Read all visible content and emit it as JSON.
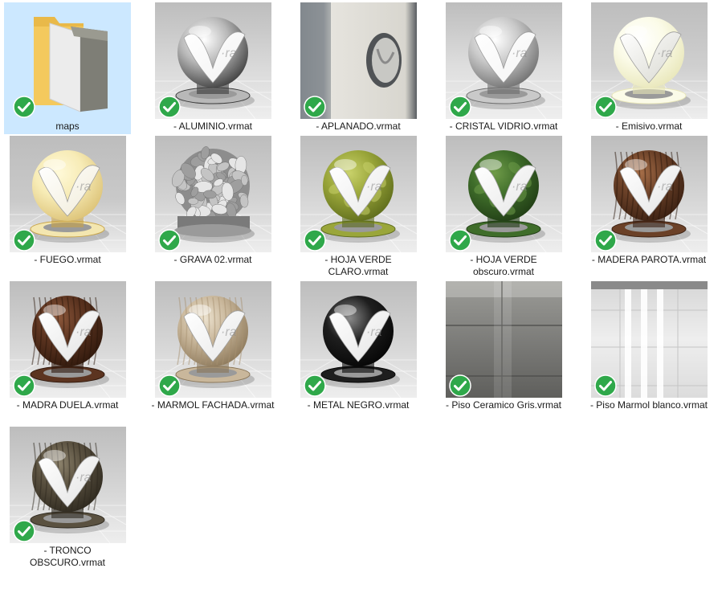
{
  "files": [
    {
      "name": "maps",
      "kind": "folder",
      "selected": true,
      "status": "synced"
    },
    {
      "name": "- ALUMINIO.vrmat",
      "kind": "chrome",
      "status": "synced"
    },
    {
      "name": "- APLANADO.vrmat",
      "kind": "plaster",
      "status": "synced"
    },
    {
      "name": "- CRISTAL VIDRIO.vrmat",
      "kind": "glass",
      "status": "synced"
    },
    {
      "name": "- Emisivo.vrmat",
      "kind": "emissive",
      "status": "synced"
    },
    {
      "name": "- FUEGO.vrmat",
      "kind": "fire",
      "status": "synced"
    },
    {
      "name": "- GRAVA 02.vrmat",
      "kind": "gravel",
      "status": "synced"
    },
    {
      "name": "- HOJA VERDE CLARO.vrmat",
      "kind": "leaf-light",
      "status": "synced"
    },
    {
      "name": "- HOJA VERDE obscuro.vrmat",
      "kind": "leaf-dark",
      "status": "synced"
    },
    {
      "name": "- MADERA PAROTA.vrmat",
      "kind": "wood-parota",
      "status": "synced"
    },
    {
      "name": "- MADRA DUELA.vrmat",
      "kind": "wood-duela",
      "status": "synced"
    },
    {
      "name": "- MARMOL FACHADA.vrmat",
      "kind": "marble-beige",
      "status": "synced"
    },
    {
      "name": "- METAL NEGRO.vrmat",
      "kind": "black-metal",
      "status": "synced"
    },
    {
      "name": "- Piso Ceramico Gris.vrmat",
      "kind": "floor-gray",
      "status": "synced"
    },
    {
      "name": "- Piso Marmol blanco.vrmat",
      "kind": "floor-white",
      "status": "synced"
    },
    {
      "name": "- TRONCO OBSCURO.vrmat",
      "kind": "bark",
      "status": "synced"
    }
  ],
  "colors": {
    "selection": "#cce8ff",
    "badge_green": "#2fa84a",
    "folder_yellow": "#f4c95d"
  }
}
